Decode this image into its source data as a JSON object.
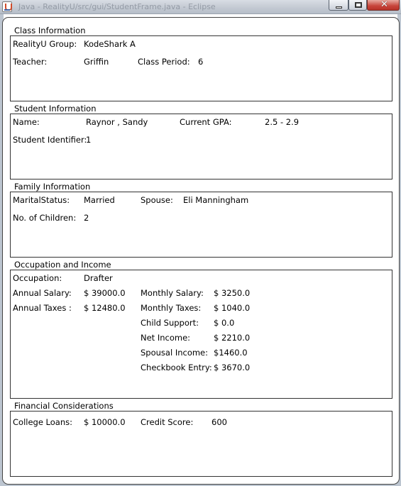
{
  "window": {
    "title": "Java - RealityU/src/gui/StudentFrame.java - Eclipse",
    "min_icon": "minimize-icon",
    "max_icon": "maximize-icon",
    "close_icon": "close-icon",
    "close_glyph": "✕"
  },
  "class_info": {
    "title": "Class Information",
    "group_label": "RealityU Group:",
    "group_value": "KodeShark A",
    "teacher_label": "Teacher:",
    "teacher_value": "Griffin",
    "period_label": "Class Period:",
    "period_value": "6"
  },
  "student_info": {
    "title": "Student Information",
    "name_label": "Name:",
    "name_value": "Raynor , Sandy",
    "gpa_label": "Current GPA:",
    "gpa_value": "2.5 - 2.9",
    "id_label": "Student Identifier:",
    "id_value": "1"
  },
  "family_info": {
    "title": "Family Information",
    "marital_label": "MaritalStatus:",
    "marital_value": "Married",
    "spouse_label": "Spouse:",
    "spouse_value": "Eli Manningham",
    "children_label": "No. of Children:",
    "children_value": "2"
  },
  "occupation": {
    "title": "Occupation and Income",
    "occupation_label": "Occupation:",
    "occupation_value": "Drafter",
    "annual_salary_label": "Annual Salary:",
    "annual_salary_value": "$ 39000.0",
    "annual_taxes_label": "Annual Taxes :",
    "annual_taxes_value": "$ 12480.0",
    "monthly_salary_label": "Monthly Salary:",
    "monthly_salary_value": "$ 3250.0",
    "monthly_taxes_label": "Monthly Taxes:",
    "monthly_taxes_value": "$ 1040.0",
    "child_support_label": "Child Support:",
    "child_support_value": "$ 0.0",
    "net_income_label": "Net Income:",
    "net_income_value": "$ 2210.0",
    "spousal_income_label": "Spousal Income:",
    "spousal_income_value": "$1460.0",
    "checkbook_label": "Checkbook Entry:",
    "checkbook_value": "$ 3670.0"
  },
  "financial": {
    "title": "Financial Considerations",
    "loans_label": "College Loans:",
    "loans_value": "$ 10000.0",
    "credit_label": "Credit Score:",
    "credit_value": "600"
  }
}
